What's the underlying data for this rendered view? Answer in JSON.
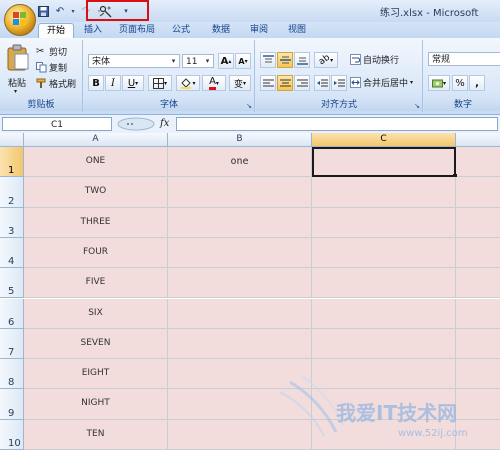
{
  "window": {
    "title": "练习.xlsx - Microsoft"
  },
  "quick_access": {
    "items": [
      "save",
      "undo",
      "redo",
      "custom",
      "more"
    ]
  },
  "tabs": [
    "开始",
    "插入",
    "页面布局",
    "公式",
    "数据",
    "审阅",
    "视图"
  ],
  "ribbon": {
    "clipboard": {
      "paste_label": "粘贴",
      "cut_label": "剪切",
      "copy_label": "复制",
      "format_painter_label": "格式刷",
      "group_label": "剪贴板"
    },
    "font": {
      "font_name": "宋体",
      "font_size": "11",
      "grow_label": "A",
      "shrink_label": "A",
      "bold_label": "B",
      "italic_label": "I",
      "underline_label": "U",
      "font_color_label": "A",
      "phonetic_label": "变",
      "group_label": "字体"
    },
    "alignment": {
      "wrap_text_label": "自动换行",
      "merge_label": "合并后居中",
      "group_label": "对齐方式"
    },
    "number": {
      "format": "常规",
      "percent_label": "%",
      "comma_label": ",",
      "group_label": "数字"
    }
  },
  "formula_bar": {
    "name_box": "C1",
    "fx_label": "fx",
    "formula": ""
  },
  "columns": [
    "A",
    "B",
    "C"
  ],
  "rows": [
    "1",
    "2",
    "3",
    "4",
    "5",
    "6",
    "7",
    "8",
    "9",
    "10"
  ],
  "column_a": [
    "ONE",
    "TWO",
    "THREE",
    "FOUR",
    "FIVE",
    "SIX",
    "SEVEN",
    "EIGHT",
    "NIGHT",
    "TEN"
  ],
  "column_b": [
    "one",
    "",
    "",
    "",
    "",
    "",
    "",
    "",
    "",
    ""
  ],
  "selected_cell": "C1",
  "colors": {
    "cell_fill": "#f2dcdc",
    "selection_header": "#f3c66c",
    "highlight_box": "#d81010",
    "ribbon": "#d9e7f8"
  },
  "watermark": {
    "text": "我爱IT技术网",
    "url": "www.52ij.com"
  }
}
